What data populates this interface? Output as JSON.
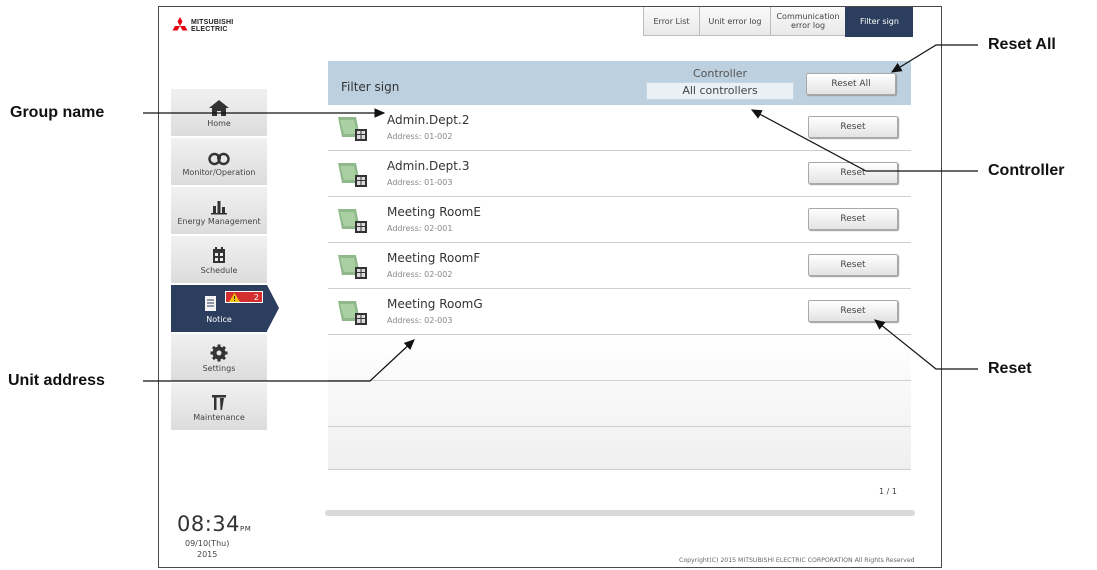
{
  "logo": {
    "line1": "MITSUBISHI",
    "line2": "ELECTRIC"
  },
  "tabs": [
    {
      "label": "Error List"
    },
    {
      "label": "Unit error log"
    },
    {
      "label": "Communication error log"
    },
    {
      "label": "Filter sign",
      "active": true
    }
  ],
  "sidebar": {
    "items": [
      {
        "label": "Home",
        "icon": "home-icon"
      },
      {
        "label": "Monitor/Operation",
        "icon": "binoculars-icon"
      },
      {
        "label": "Energy Management",
        "icon": "bar-chart-icon"
      },
      {
        "label": "Schedule",
        "icon": "calendar-icon"
      },
      {
        "label": "Notice",
        "icon": "notice-icon",
        "active": true,
        "badge": "2"
      },
      {
        "label": "Settings",
        "icon": "gear-icon"
      },
      {
        "label": "Maintenance",
        "icon": "maintenance-icon"
      }
    ]
  },
  "clock": {
    "time": "08:34",
    "ampm": "PM",
    "date": "09/10(Thu)",
    "year": "2015"
  },
  "panel": {
    "title": "Filter sign",
    "controller_label": "Controller",
    "controller_value": "All controllers",
    "reset_all_label": "Reset All"
  },
  "rows": [
    {
      "name": "Admin.Dept.2",
      "address": "Address: 01-002",
      "button": "Reset"
    },
    {
      "name": "Admin.Dept.3",
      "address": "Address: 01-003",
      "button": "Reset"
    },
    {
      "name": "Meeting RoomE",
      "address": "Address: 02-001",
      "button": "Reset"
    },
    {
      "name": "Meeting RoomF",
      "address": "Address: 02-002",
      "button": "Reset"
    },
    {
      "name": "Meeting RoomG",
      "address": "Address: 02-003",
      "button": "Reset"
    }
  ],
  "pager": "1 / 1",
  "copyright": "Copyright(C) 2015 MITSUBISHI ELECTRIC CORPORATION All Rights Reserved",
  "annotations": {
    "reset_all": "Reset All",
    "group_name": "Group name",
    "controller": "Controller",
    "unit_address": "Unit address",
    "reset": "Reset"
  },
  "colors": {
    "nav_active": "#2c3e5e",
    "header": "#bcd0df",
    "badge": "#d32f2f",
    "logo_red": "#e60012"
  }
}
